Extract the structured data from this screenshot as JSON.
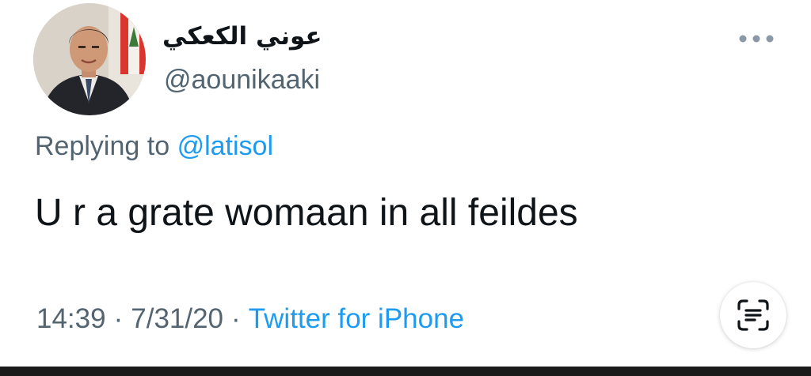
{
  "author": {
    "display_name": "عوني الكعكي",
    "handle": "@aounikaaki"
  },
  "reply": {
    "prefix": "Replying to",
    "mention": "@latisol"
  },
  "tweet": {
    "text": "U r a grate womaan in all feildes"
  },
  "meta": {
    "time": "14:39",
    "separator": "·",
    "date": "7/31/20",
    "source": "Twitter for iPhone"
  },
  "icons": {
    "more": "more-horizontal-icon",
    "scan": "live-text-scan-icon"
  },
  "colors": {
    "text_primary": "#0f1419",
    "text_secondary": "#536471",
    "accent": "#1d9bf0"
  }
}
